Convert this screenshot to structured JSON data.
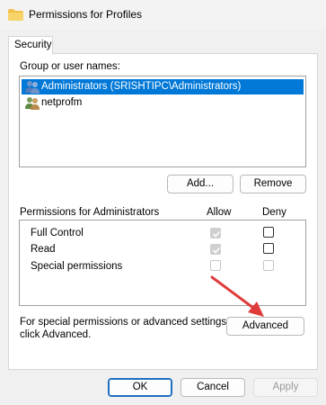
{
  "window": {
    "title": "Permissions for Profiles"
  },
  "tabs": [
    {
      "label": "Security"
    }
  ],
  "group_label": "Group or user names:",
  "users": [
    {
      "name": "Administrators (SRISHTIPC\\Administrators)",
      "selected": true,
      "icon": "user-group-icon"
    },
    {
      "name": "netprofm",
      "selected": false,
      "icon": "user-icon"
    }
  ],
  "buttons": {
    "add": "Add...",
    "remove": "Remove",
    "advanced": "Advanced",
    "ok": "OK",
    "cancel": "Cancel",
    "apply": "Apply"
  },
  "permissions": {
    "header": "Permissions for Administrators",
    "allow_label": "Allow",
    "deny_label": "Deny",
    "rows": [
      {
        "name": "Full Control",
        "allow": true,
        "deny": false
      },
      {
        "name": "Read",
        "allow": true,
        "deny": false
      },
      {
        "name": "Special permissions",
        "allow": false,
        "deny": false
      }
    ]
  },
  "advanced_hint": "For special permissions or advanced settings, click Advanced.",
  "advanced_hint_line1": "For special permissions or advanced settings,",
  "advanced_hint_line2": "click Advanced.",
  "colors": {
    "selection": "#0078d7",
    "arrow": "#e03b3b",
    "ok_border": "#1f6fc1"
  }
}
